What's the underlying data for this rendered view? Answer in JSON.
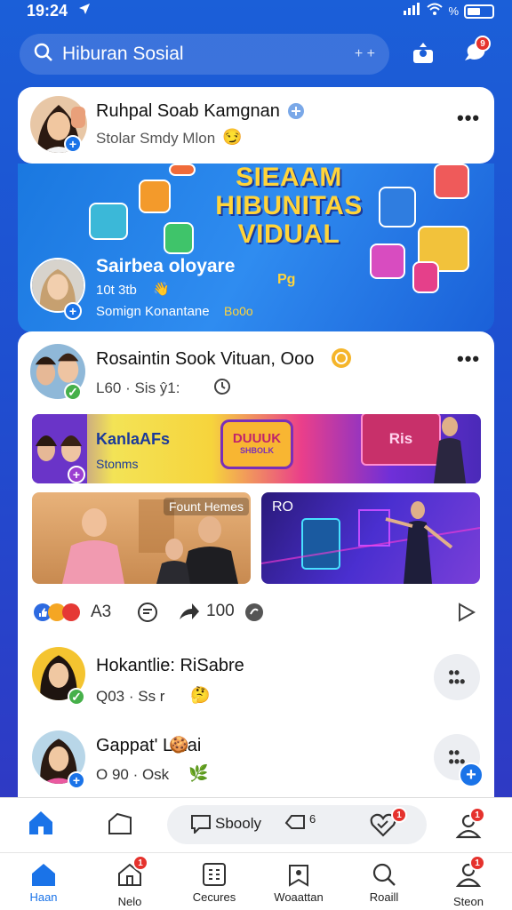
{
  "status": {
    "time": "19:24",
    "battery": "%"
  },
  "search": {
    "query": "Hiburan Sosial"
  },
  "header": {
    "notif_badge": "9"
  },
  "post1": {
    "name": "Ruhpal Soab Kamgnan",
    "sub": "Stolar Smdy Mlon",
    "emoji": "😏"
  },
  "banner": {
    "title_line1": "SIEAAM",
    "title_line2": "HIBUNITAS",
    "title_line3": "VIDUAL",
    "user_name": "Sairbea oloyare",
    "user_sub": "10t 3tb",
    "user_caption": "Somign Konantane",
    "caption_tag": "Bo0o",
    "pg": "Pg"
  },
  "post2": {
    "name": "Rosaintin Sook Vituan, Ooo",
    "meta": "L60 · Sis ŷ1:",
    "strip_title": "KanlaAFs",
    "strip_sub": "Stonms",
    "strip_badge_line1": "DUUUK",
    "strip_badge_line2": "SHBOLK",
    "strip_sign": "Ris",
    "photo1_label": "Fount Hemes",
    "photo2_label": "RO",
    "reactions": {
      "count": "A3",
      "shares": "100"
    }
  },
  "user1": {
    "name": "Hokantlie: RiSabre",
    "meta": "Q03 · Ss r"
  },
  "user2": {
    "name": "Gappat' Lmai",
    "meta": "O 90 · Osk"
  },
  "tabbar_top": {
    "pill_item1": "Sbooly",
    "pill_item2": "6",
    "heart_badge": "1",
    "profile_badge": "1"
  },
  "nav": {
    "items": [
      {
        "label": "Haan",
        "badge": ""
      },
      {
        "label": "Nelo",
        "badge": "1"
      },
      {
        "label": "Cecures",
        "badge": ""
      },
      {
        "label": "Woaattan",
        "badge": ""
      },
      {
        "label": "Roaill",
        "badge": ""
      },
      {
        "label": "Steon",
        "badge": "1"
      }
    ]
  },
  "colors": {
    "brand": "#1a73e8",
    "badge": "#e5322d",
    "accent_yellow": "#ffd43a"
  }
}
